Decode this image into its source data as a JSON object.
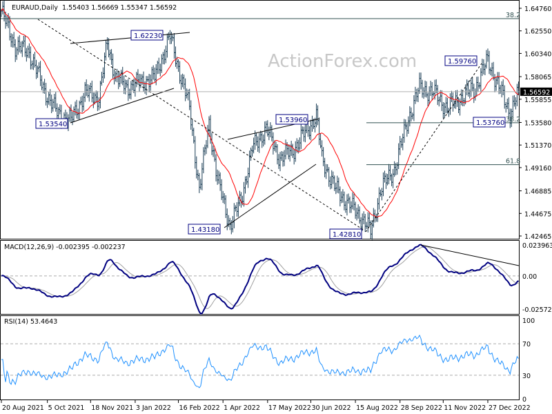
{
  "chart_data": {
    "type": "ohlc",
    "title": "EURAUD,Daily",
    "ohlc_readout": [
      "1.55403",
      "1.56669",
      "1.55347",
      "1.56592"
    ],
    "current_price": 1.56592,
    "current_price_label": "1.56592",
    "price_ticks": [
      "1.64760",
      "1.62550",
      "1.60340",
      "1.58065",
      "1.55855",
      "1.53580",
      "1.51370",
      "1.49160",
      "1.46885",
      "1.44675",
      "1.42465"
    ],
    "price_tick_values": [
      1.6476,
      1.6255,
      1.6034,
      1.58065,
      1.55855,
      1.5358,
      1.5137,
      1.4916,
      1.46885,
      1.44675,
      1.42465
    ],
    "date_ticks": [
      "20 Aug 2021",
      "5 Oct 2021",
      "18 Nov 2021",
      "3 Jan 2022",
      "16 Feb 2022",
      "1 Apr 2022",
      "17 May 2022",
      "30 Jun 2022",
      "15 Aug 2022",
      "28 Sep 2022",
      "11 Nov 2022",
      "27 Dec 2022"
    ],
    "date_tick_bar_index": [
      0,
      33,
      64,
      96,
      127,
      159,
      191,
      222,
      254,
      286,
      317,
      349
    ],
    "close_anchors": [
      [
        0,
        1.645
      ],
      [
        10,
        1.61
      ],
      [
        20,
        1.605
      ],
      [
        30,
        1.57
      ],
      [
        40,
        1.545
      ],
      [
        50,
        1.538
      ],
      [
        60,
        1.565
      ],
      [
        70,
        1.56
      ],
      [
        76,
        1.613
      ],
      [
        82,
        1.58
      ],
      [
        90,
        1.57
      ],
      [
        100,
        1.575
      ],
      [
        110,
        1.58
      ],
      [
        121,
        1.62
      ],
      [
        127,
        1.59
      ],
      [
        135,
        1.55
      ],
      [
        142,
        1.47
      ],
      [
        149,
        1.535
      ],
      [
        155,
        1.48
      ],
      [
        164,
        1.435
      ],
      [
        172,
        1.46
      ],
      [
        180,
        1.51
      ],
      [
        190,
        1.53
      ],
      [
        200,
        1.5
      ],
      [
        210,
        1.51
      ],
      [
        220,
        1.53
      ],
      [
        226,
        1.542
      ],
      [
        230,
        1.5
      ],
      [
        240,
        1.47
      ],
      [
        250,
        1.455
      ],
      [
        260,
        1.44
      ],
      [
        265,
        1.429
      ],
      [
        272,
        1.47
      ],
      [
        282,
        1.49
      ],
      [
        292,
        1.54
      ],
      [
        300,
        1.57
      ],
      [
        310,
        1.565
      ],
      [
        320,
        1.55
      ],
      [
        330,
        1.56
      ],
      [
        340,
        1.57
      ],
      [
        349,
        1.597
      ],
      [
        357,
        1.57
      ],
      [
        365,
        1.545
      ],
      [
        371,
        1.566
      ]
    ],
    "ma_period": 20,
    "annotations": [
      "1.62230",
      "1.53540",
      "1.53960",
      "1.43180",
      "1.42810",
      "1.59760",
      "1.53760"
    ],
    "fib_labels": [
      "38.2",
      "38.2",
      "61.8"
    ],
    "fib_values": [
      1.6375,
      1.5355,
      1.4945
    ],
    "macd": {
      "title": "MACD(12,26,9) -0.002395 -0.002237",
      "ticks": [
        "0.023963",
        "0.00",
        "-0.025726"
      ],
      "range": [
        -0.025726,
        0.023963
      ]
    },
    "rsi": {
      "title": "RSI(14) 53.4643",
      "ticks": [
        "100",
        "70",
        "30",
        "0"
      ],
      "levels": [
        100,
        70,
        30,
        0
      ]
    },
    "colors": {
      "bars": "#1a3d55",
      "ma": "#ff0000",
      "macd": "#000080",
      "signal": "#a0a0a0",
      "rsi": "#1e90ff"
    }
  },
  "watermark": "ActionForex.com"
}
